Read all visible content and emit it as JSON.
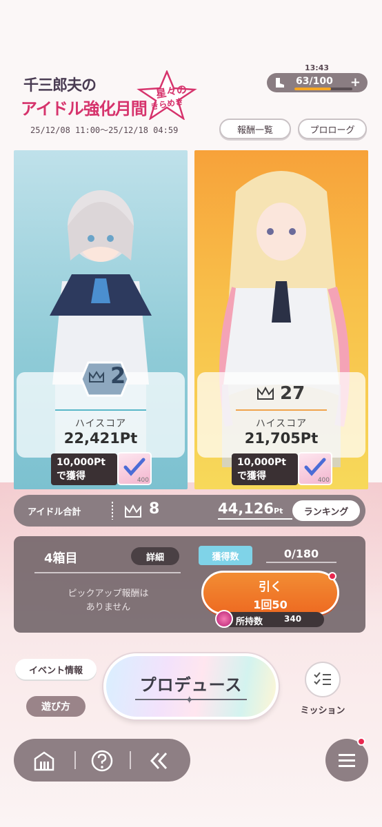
{
  "event": {
    "title_line1": "千三郎夫の",
    "title_line2": "アイドル強化月間",
    "star_text1": "星々の",
    "star_text2": "きらめき",
    "period": "25/12/08 11:00～25/12/18 04:59"
  },
  "status": {
    "clock": "13:43",
    "stamina_value": "63/100",
    "stamina_current": 63,
    "stamina_max": 100,
    "plus": "+"
  },
  "header_buttons": {
    "rewards": "報酬一覧",
    "prologue": "プロローグ"
  },
  "cards": [
    {
      "rank": "2",
      "highscore_label": "ハイスコア",
      "highscore_value": "22,421Pt",
      "acquire_line1": "10,000Pt",
      "acquire_line2": "で獲得",
      "ticket_count": "400"
    },
    {
      "rank": "27",
      "highscore_label": "ハイスコア",
      "highscore_value": "21,705Pt",
      "acquire_line1": "10,000Pt",
      "acquire_line2": "で獲得",
      "ticket_count": "400"
    }
  ],
  "total": {
    "label": "アイドル合計",
    "rank": "8",
    "points": "44,126",
    "points_unit": "Pt",
    "ranking_button": "ランキング"
  },
  "gacha": {
    "box_label": "4箱目",
    "detail_button": "詳細",
    "acquired_label": "獲得数",
    "acquired_value": "0/180",
    "no_pickup_line1": "ピックアップ報酬は",
    "no_pickup_line2": "ありません",
    "draw_line1": "引く",
    "draw_line2": "1回50",
    "owned_label": "所持数",
    "owned_value": "340"
  },
  "actions": {
    "event_info": "イベント情報",
    "how_to_play": "遊び方",
    "produce": "プロデュース",
    "mission": "ミッション"
  },
  "colors": {
    "accent_pink": "#d6336c",
    "draw_orange": "#ee6b22",
    "notification_red": "#e8274f",
    "panel_gray": "#8a7d82"
  }
}
